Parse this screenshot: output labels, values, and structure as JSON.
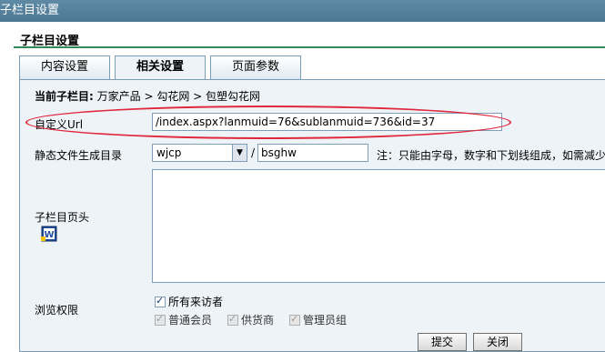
{
  "window": {
    "title": "子栏目设置"
  },
  "section": {
    "title": "子栏目设置"
  },
  "tabs": [
    {
      "label": "内容设置"
    },
    {
      "label": "相关设置"
    },
    {
      "label": "页面参数"
    }
  ],
  "breadcrumb": {
    "label": "当前子栏目:",
    "path": "万家产品 > 勾花网 > 包塑勾花网"
  },
  "fields": {
    "custom_url": {
      "label": "自定义Url",
      "value": "/index.aspx?lanmuid=76&sublanmuid=736&id=37"
    },
    "static_dir": {
      "label": "静态文件生成目录",
      "select_value": "wjcp",
      "slash": "/",
      "folder_value": "bsghw",
      "note": "注：只能由字母，数字和下划线组成，如需减少"
    },
    "header": {
      "label": "子栏目页头"
    },
    "permissions": {
      "label": "浏览权限",
      "options": [
        {
          "label": "所有来访者",
          "checked": true,
          "disabled": false
        },
        {
          "label": "普通会员",
          "checked": true,
          "disabled": true
        },
        {
          "label": "供货商",
          "checked": true,
          "disabled": true
        },
        {
          "label": "管理员组",
          "checked": true,
          "disabled": true
        }
      ]
    }
  },
  "buttons": {
    "submit": "提交",
    "close": "关闭"
  },
  "colors": {
    "titlebar": "#4d7893",
    "accent_line": "#2e8b57",
    "highlight": "#e0283c",
    "panel": "#eef3f8"
  },
  "icons": {
    "editor": "word-document-icon",
    "dropdown": "chevron-down-icon"
  }
}
